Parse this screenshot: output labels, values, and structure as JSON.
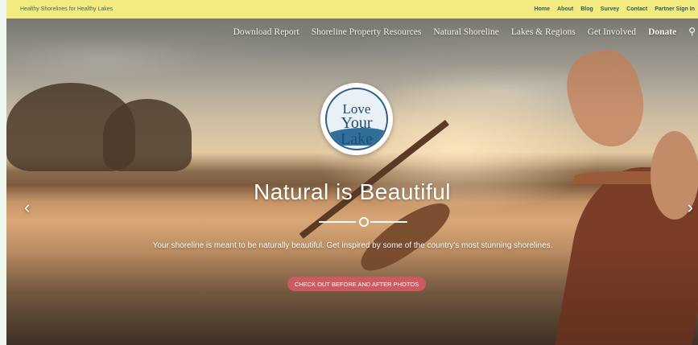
{
  "topbar": {
    "tagline": "Healthy Shorelines for Healthy Lakes",
    "links": [
      "Home",
      "About",
      "Blog",
      "Survey",
      "Contact",
      "Partner Sign In"
    ]
  },
  "nav": {
    "items": [
      "Download Report",
      "Shoreline Property Resources",
      "Natural Shoreline",
      "Lakes & Regions",
      "Get Involved",
      "Donate"
    ],
    "search_icon": "search-icon"
  },
  "logo": {
    "line1": "Love",
    "line2": "Your Lake"
  },
  "hero": {
    "headline": "Natural is Beautiful",
    "subtext": "Your shoreline is  meant to be naturally beautiful. Get inspired by some of the country's most stunning shorelines.",
    "cta_label": "CHECK OUT BEFORE AND AFTER PHOTOS",
    "prev_arrow": "‹",
    "next_arrow": "›"
  },
  "colors": {
    "topbar_bg": "#f3eb80",
    "cta_bg": "#cc5a5f",
    "logo_blue": "#1f4b78"
  }
}
